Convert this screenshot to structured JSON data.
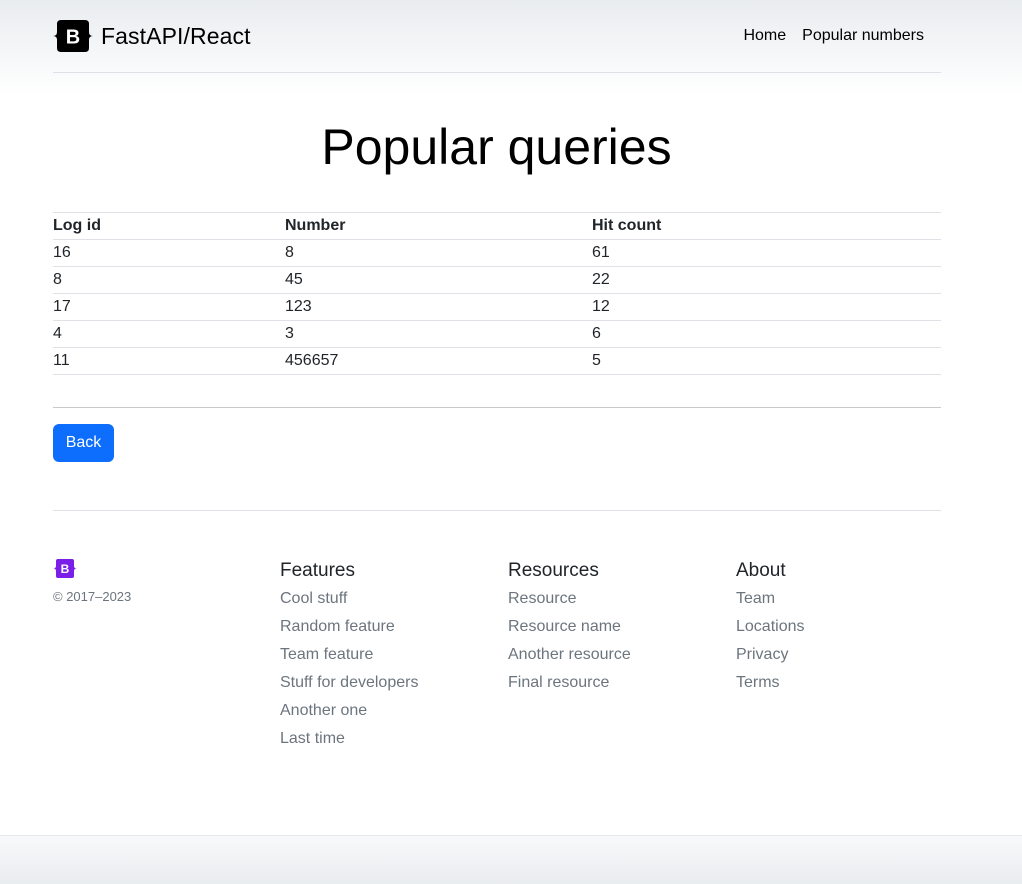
{
  "header": {
    "brand_logo_letter": "B",
    "brand_name": "FastAPI/React",
    "nav": [
      {
        "label": "Home"
      },
      {
        "label": "Popular numbers"
      }
    ]
  },
  "main": {
    "title": "Popular queries",
    "table": {
      "columns": [
        "Log id",
        "Number",
        "Hit count"
      ],
      "rows": [
        [
          "16",
          "8",
          "61"
        ],
        [
          "8",
          "45",
          "22"
        ],
        [
          "17",
          "123",
          "12"
        ],
        [
          "4",
          "3",
          "6"
        ],
        [
          "11",
          "456657",
          "5"
        ]
      ]
    },
    "back_label": "Back"
  },
  "footer": {
    "logo_letter": "B",
    "copyright": "© 2017–2023",
    "columns": [
      {
        "heading": "Features",
        "links": [
          "Cool stuff",
          "Random feature",
          "Team feature",
          "Stuff for developers",
          "Another one",
          "Last time"
        ]
      },
      {
        "heading": "Resources",
        "links": [
          "Resource",
          "Resource name",
          "Another resource",
          "Final resource"
        ]
      },
      {
        "heading": "About",
        "links": [
          "Team",
          "Locations",
          "Privacy",
          "Terms"
        ]
      }
    ]
  },
  "colors": {
    "accent": "#0d6efd",
    "brand_purple": "#7a1ee8",
    "muted_text": "#6c757d"
  }
}
